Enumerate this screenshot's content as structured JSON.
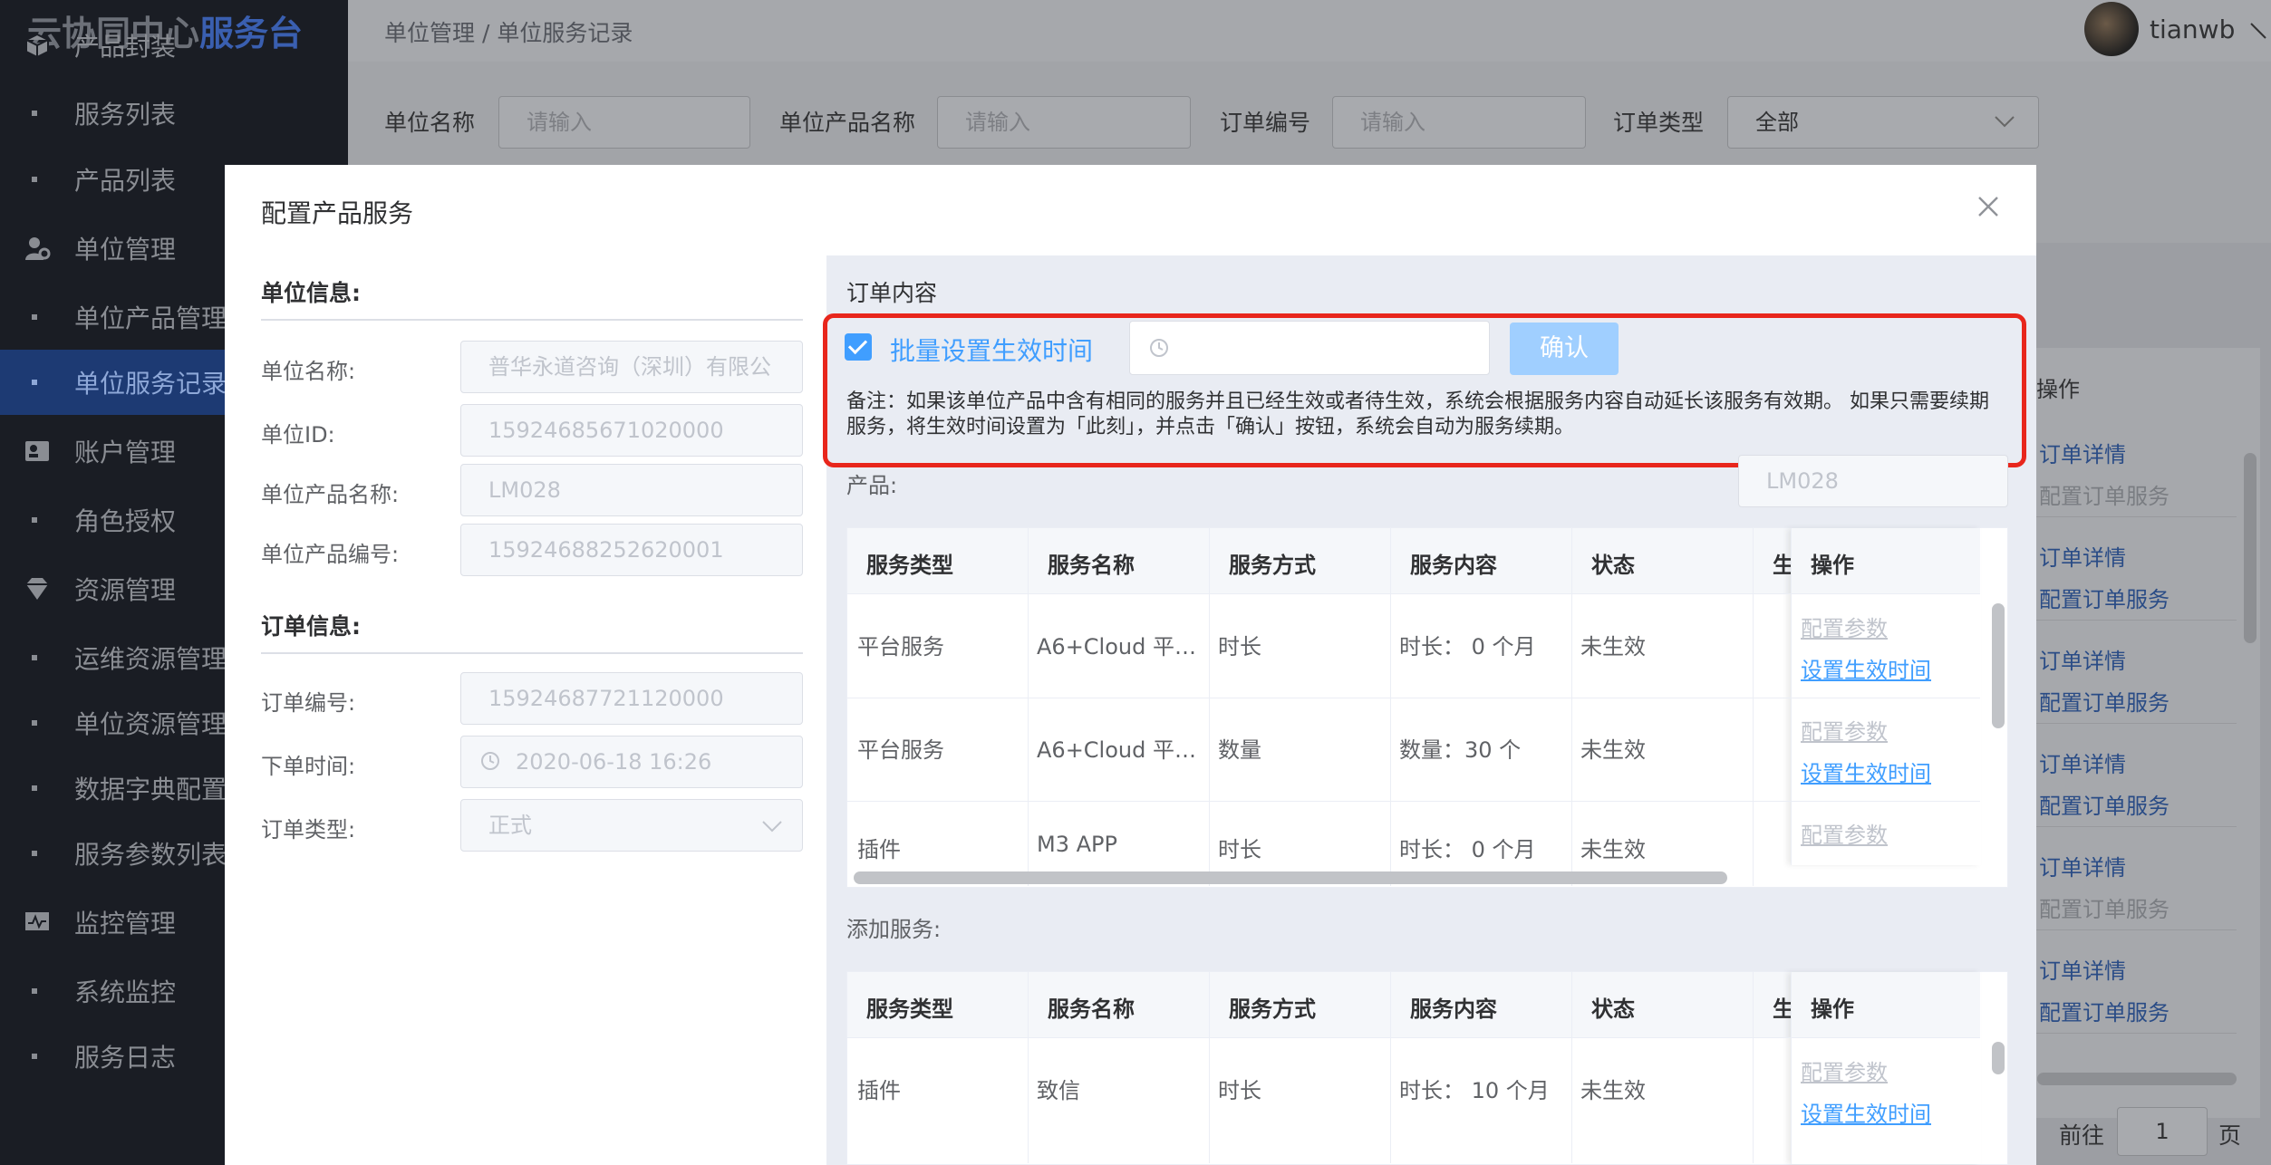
{
  "app": {
    "logo_a": "云协同中心",
    "logo_b": "服务台"
  },
  "sidebar": {
    "items": [
      {
        "label": "产品封装",
        "type": "group",
        "icon": "cube-icon"
      },
      {
        "label": "服务列表",
        "type": "sub"
      },
      {
        "label": "产品列表",
        "type": "sub"
      },
      {
        "label": "单位管理",
        "type": "group",
        "icon": "user-gear-icon"
      },
      {
        "label": "单位产品管理",
        "type": "sub"
      },
      {
        "label": "单位服务记录",
        "type": "sub",
        "active": true
      },
      {
        "label": "账户管理",
        "type": "group",
        "icon": "id-card-icon"
      },
      {
        "label": "角色授权",
        "type": "sub"
      },
      {
        "label": "资源管理",
        "type": "group",
        "icon": "diamond-icon"
      },
      {
        "label": "运维资源管理",
        "type": "sub"
      },
      {
        "label": "单位资源管理",
        "type": "sub"
      },
      {
        "label": "数据字典配置",
        "type": "sub"
      },
      {
        "label": "服务参数列表",
        "type": "sub"
      },
      {
        "label": "监控管理",
        "type": "group",
        "icon": "monitor-icon"
      },
      {
        "label": "系统监控",
        "type": "sub"
      },
      {
        "label": "服务日志",
        "type": "sub"
      }
    ]
  },
  "header": {
    "breadcrumb": "单位管理 / 单位服务记录",
    "username": "tianwb"
  },
  "filters": {
    "unit_name_label": "单位名称",
    "unit_name_ph": "请输入",
    "unit_product_label": "单位产品名称",
    "unit_product_ph": "请输入",
    "order_no_label": "订单编号",
    "order_no_ph": "请输入",
    "order_type_label": "订单类型",
    "order_type_value": "全部"
  },
  "background_table": {
    "header": "操作",
    "rows": [
      {
        "a": "订单详情",
        "b": "配置订单服务",
        "b_disabled": true
      },
      {
        "a": "订单详情",
        "b": "配置订单服务",
        "b_disabled": false
      },
      {
        "a": "订单详情",
        "b": "配置订单服务",
        "b_disabled": false
      },
      {
        "a": "订单详情",
        "b": "配置订单服务",
        "b_disabled": false
      },
      {
        "a": "订单详情",
        "b": "配置订单服务",
        "b_disabled": true
      },
      {
        "a": "订单详情",
        "b": "配置订单服务",
        "b_disabled": false
      }
    ],
    "goto_label": "前往",
    "page": "1",
    "page_unit": "页"
  },
  "modal": {
    "title": "配置产品服务",
    "unit_info": {
      "heading": "单位信息:",
      "name_label": "单位名称:",
      "name_value": "普华永道咨询（深圳）有限公",
      "id_label": "单位ID:",
      "id_value": "15924685671020000",
      "product_label": "单位产品名称:",
      "product_value": "LM028",
      "product_no_label": "单位产品编号:",
      "product_no_value": "15924688252620001"
    },
    "order_info": {
      "heading": "订单信息:",
      "no_label": "订单编号:",
      "no_value": "15924687721120000",
      "time_label": "下单时间:",
      "time_value": "2020-06-18 16:26",
      "type_label": "订单类型:",
      "type_value": "正式"
    },
    "order_content": {
      "heading": "订单内容",
      "batch_label": "批量设置生效时间",
      "confirm_label": "确认",
      "note": "备注：如果该单位产品中含有相同的服务并且已经生效或者待生效，系统会根据服务内容自动延长该服务有效期。 如果只需要续期服务，将生效时间设置为「此刻」，并点击「确认」按钮，系统会自动为服务续期。",
      "product_label": "产品:",
      "product_value": "LM028"
    },
    "columns": [
      "服务类型",
      "服务名称",
      "服务方式",
      "服务内容",
      "状态",
      "生",
      "操作"
    ],
    "rows": [
      {
        "type": "平台服务",
        "name": "A6+Cloud 平…",
        "mode": "时长",
        "content": "时长： 0 个月",
        "status": "未生效",
        "op1": "配置参数",
        "op2": "设置生效时间"
      },
      {
        "type": "平台服务",
        "name": "A6+Cloud 平…",
        "mode": "数量",
        "content": "数量：30 个",
        "status": "未生效",
        "op1": "配置参数",
        "op2": "设置生效时间"
      },
      {
        "type": "插件",
        "name": "M3 APP",
        "mode": "时长",
        "content": "时长： 0 个月",
        "status": "未生效",
        "op1": "配置参数",
        "op2": ""
      }
    ],
    "add_label": "添加服务:",
    "add_rows": [
      {
        "type": "插件",
        "name": "致信",
        "mode": "时长",
        "content": "时长： 10 个月",
        "status": "未生效",
        "op1": "配置参数",
        "op2": "设置生效时间"
      }
    ]
  },
  "colors": {
    "accent": "#409eff",
    "highlight": "#e8261c",
    "sidebar": "#1a1d24"
  }
}
